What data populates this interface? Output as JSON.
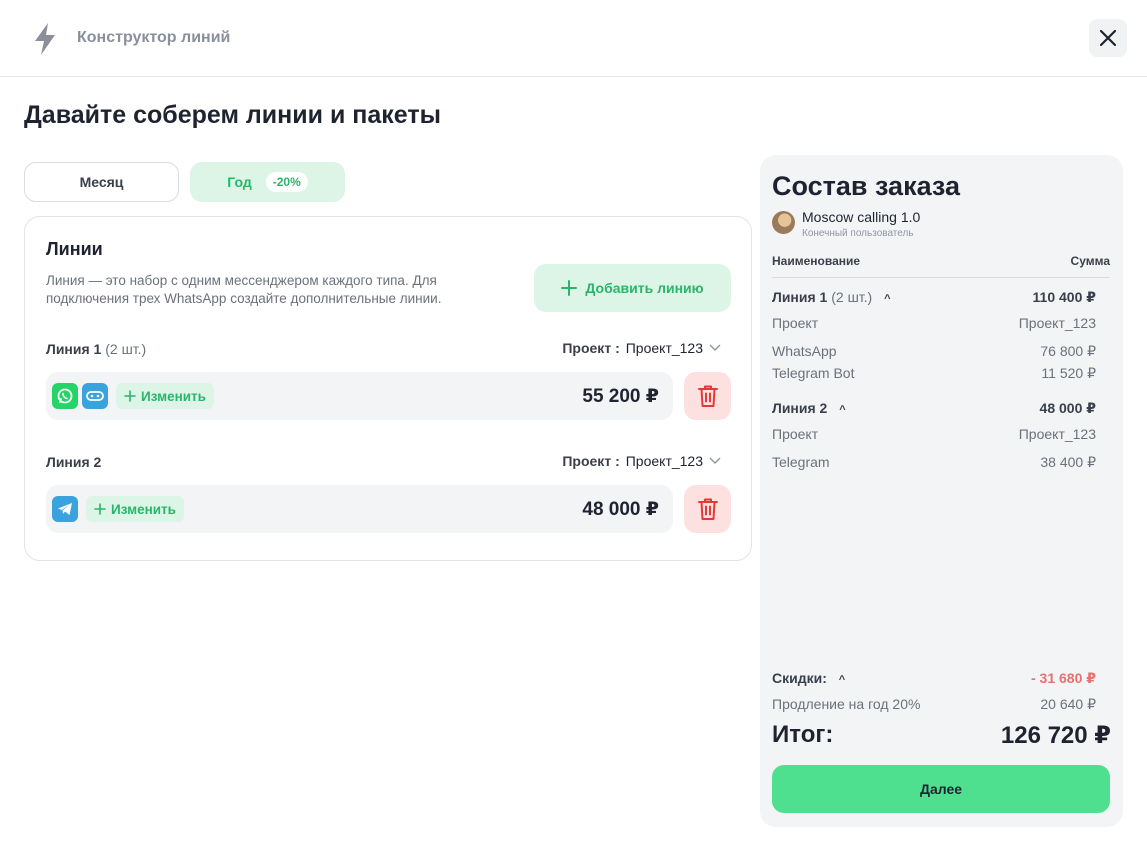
{
  "header": {
    "app_title": "Конструктор линий",
    "logo_icon": "lightning-icon",
    "close_icon": "close-icon"
  },
  "page_title": "Давайте соберем линии и пакеты",
  "period": {
    "month_label": "Месяц",
    "year_label": "Год",
    "year_discount": "-20%",
    "selected": "Год"
  },
  "lines": {
    "heading": "Линии",
    "description": "Линия — это набор с одним мессенджером каждого типа. Для подключения трех WhatsApp создайте дополнительные линии.",
    "add_button": "Добавить линию",
    "project_label": "Проект :",
    "edit_label": "Изменить",
    "items": [
      {
        "name": "Линия 1",
        "count": "(2 шт.)",
        "project": "Проект_123",
        "icons": [
          "whatsapp-icon",
          "telegram-bot-icon"
        ],
        "price": "55 200 ₽"
      },
      {
        "name": "Линия 2",
        "count": "",
        "project": "Проект_123",
        "icons": [
          "telegram-icon"
        ],
        "price": "48 000 ₽"
      }
    ]
  },
  "order": {
    "title": "Состав заказа",
    "user_name": "Moscow calling 1.0",
    "user_role": "Конечный пользователь",
    "col_name": "Наименование",
    "col_sum": "Сумма",
    "groups": [
      {
        "name": "Линия 1",
        "count": "(2 шт.)",
        "sum": "110 400 ₽",
        "project_label": "Проект",
        "project_value": "Проект_123",
        "items": [
          {
            "name": "WhatsApp",
            "sum": "76 800 ₽"
          },
          {
            "name": "Telegram Bot",
            "sum": "11 520 ₽"
          }
        ]
      },
      {
        "name": "Линия 2",
        "count": "",
        "sum": "48 000 ₽",
        "project_label": "Проект",
        "project_value": "Проект_123",
        "items": [
          {
            "name": "Telegram",
            "sum": "38 400 ₽"
          }
        ]
      }
    ],
    "discounts_label": "Скидки:",
    "discounts_value": "- 31 680 ₽",
    "renewal_label": "Продление на год 20%",
    "renewal_value": "20 640 ₽",
    "total_label": "Итог:",
    "total_value": "126 720 ₽",
    "next_button": "Далее"
  },
  "colors": {
    "accent_green": "#4fe08f",
    "green_text": "#2bb56a",
    "danger": "#e53935",
    "whatsapp": "#25d366",
    "telegram": "#3aa3dd"
  }
}
